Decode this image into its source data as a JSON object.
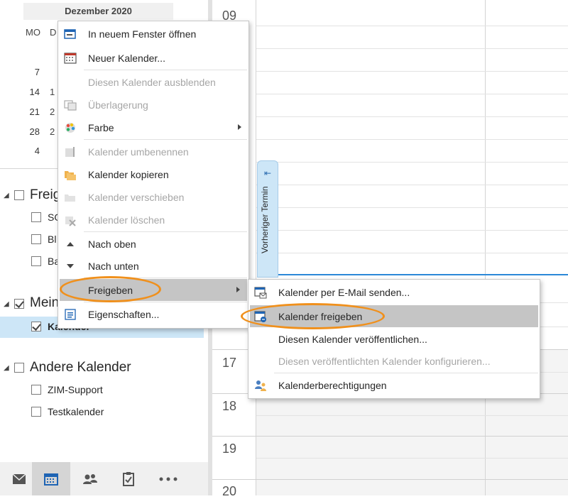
{
  "mini_calendar": {
    "month": "Dezember 2020",
    "weekday_mo": "MO",
    "weekday_di": "D",
    "week_rows": [
      "7",
      "14",
      "21",
      "28",
      "4"
    ],
    "col2": [
      "1",
      "2",
      "2"
    ]
  },
  "folders": {
    "groups": [
      {
        "label": "Freig",
        "items": [
          "SO",
          "Bl",
          "Ba"
        ]
      },
      {
        "label": "Mein",
        "items": [
          "Kalender"
        ]
      },
      {
        "label": "Andere Kalender",
        "items": [
          "ZIM-Support",
          "Testkalender"
        ]
      }
    ]
  },
  "calendar": {
    "hours": [
      "09",
      "17",
      "18",
      "19",
      "20"
    ],
    "prev_appointment": "Vorheriger Termin",
    "prev_arrow": "⇤"
  },
  "context_menu": {
    "items": [
      {
        "label": "In neuem Fenster öffnen",
        "disabled": false
      },
      {
        "label": "Neuer Kalender...",
        "disabled": false
      },
      {
        "label": "Diesen Kalender ausblenden",
        "disabled": true
      },
      {
        "label": "Überlagerung",
        "disabled": true
      },
      {
        "label": "Farbe",
        "disabled": false
      },
      {
        "label": "Kalender umbenennen",
        "disabled": true
      },
      {
        "label": "Kalender kopieren",
        "disabled": false
      },
      {
        "label": "Kalender verschieben",
        "disabled": true
      },
      {
        "label": "Kalender löschen",
        "disabled": true
      },
      {
        "label": "Nach oben",
        "disabled": false
      },
      {
        "label": "Nach unten",
        "disabled": false
      },
      {
        "label": "Freigeben",
        "disabled": false
      },
      {
        "label": "Eigenschaften...",
        "disabled": false
      }
    ]
  },
  "share_submenu": {
    "items": [
      {
        "label": "Kalender per E-Mail senden...",
        "disabled": false
      },
      {
        "label": "Kalender freigeben",
        "disabled": false
      },
      {
        "label": "Diesen Kalender veröffentlichen...",
        "disabled": false
      },
      {
        "label": "Diesen veröffentlichten Kalender konfigurieren...",
        "disabled": true
      },
      {
        "label": "Kalenderberechtigungen",
        "disabled": false
      }
    ]
  },
  "colors": {
    "accent_blue": "#2b88d8",
    "highlight_orange": "#f0901c",
    "menu_highlight": "#c5c5c5",
    "selected_row": "#cde6f7"
  },
  "bottom_nav": [
    "mail-icon",
    "calendar-icon",
    "people-icon",
    "tasks-icon",
    "more-icon"
  ]
}
